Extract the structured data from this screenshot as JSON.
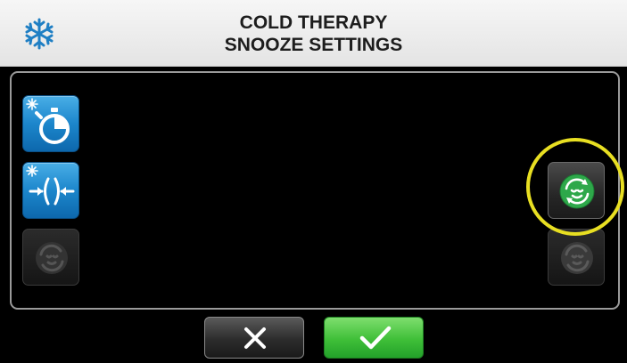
{
  "header": {
    "title_line1": "COLD THERAPY",
    "title_line2": "SNOOZE SETTINGS",
    "icon": "snowflake-icon"
  },
  "left_buttons": [
    {
      "icon": "cold-timer-icon",
      "enabled": true
    },
    {
      "icon": "cold-compression-icon",
      "enabled": true
    },
    {
      "icon": "snooze-cycle-icon",
      "enabled": false
    }
  ],
  "right_buttons": [
    {
      "icon": "snooze-cycle-icon",
      "enabled": true,
      "highlighted": true
    },
    {
      "icon": "snooze-cycle-icon",
      "enabled": false
    }
  ],
  "footer": {
    "cancel_icon": "x-icon",
    "confirm_icon": "checkmark-icon"
  },
  "colors": {
    "accent_blue": "#1c86cc",
    "confirm_green": "#3fbf38",
    "snooze_green": "#2ea84a",
    "highlight_yellow": "#e8df22",
    "header_bg": "#eeeeee"
  }
}
